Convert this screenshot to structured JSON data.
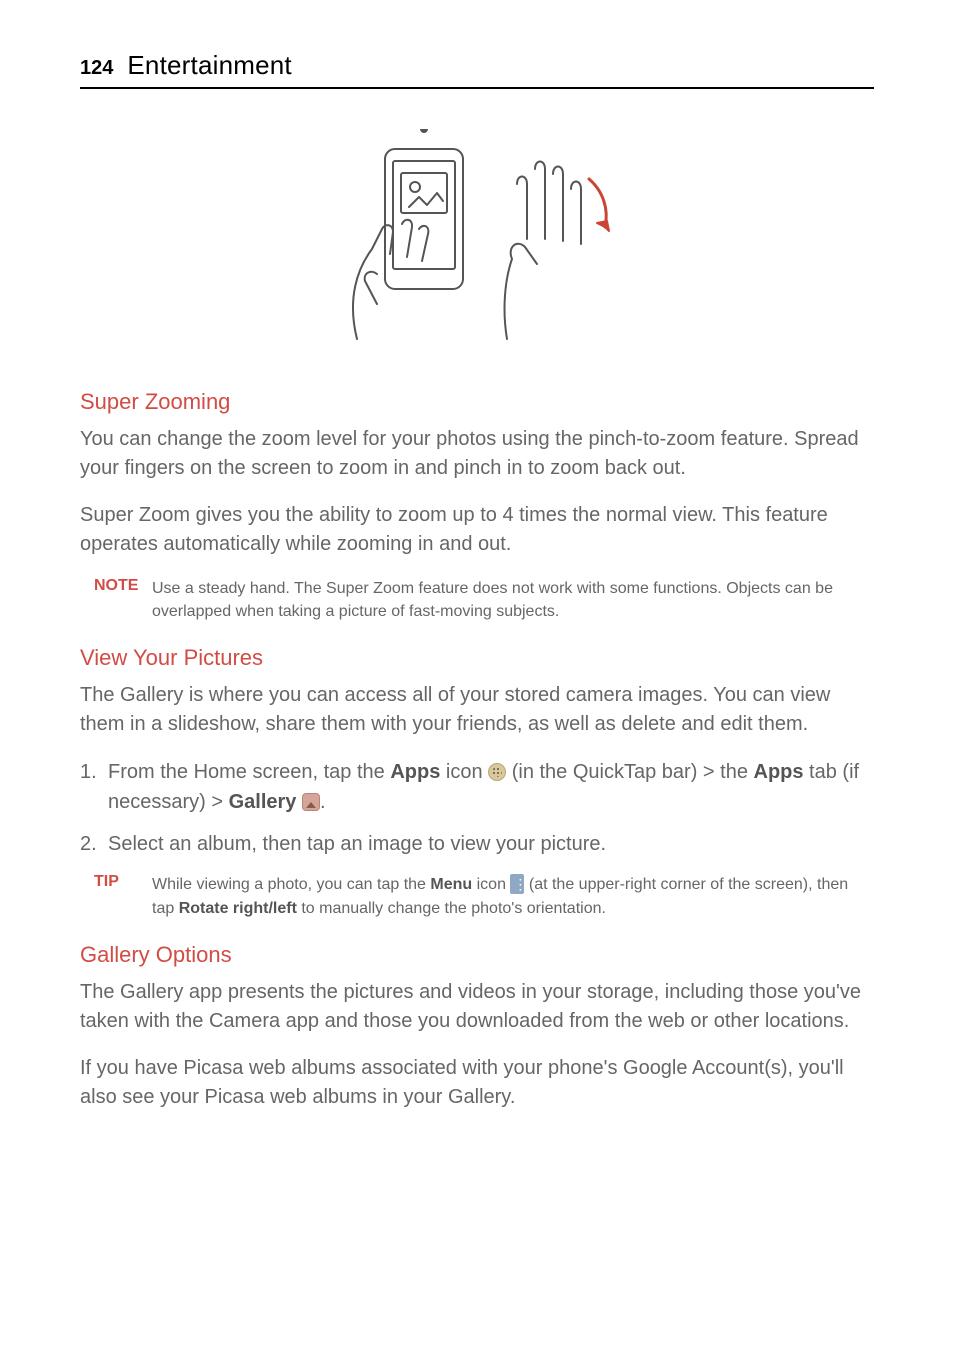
{
  "header": {
    "page_number": "124",
    "title": "Entertainment"
  },
  "sections": {
    "super_zooming": {
      "title": "Super Zooming",
      "p1": "You can change the zoom level for your photos using the pinch-to-zoom feature. Spread your fingers on the screen to zoom in and pinch in to zoom back out.",
      "p2": "Super Zoom gives you the ability to zoom up to 4 times the normal view. This feature operates automatically while zooming in and out.",
      "note_label": "NOTE",
      "note_text": "Use a steady hand. The Super Zoom feature does not work with some functions. Objects can be overlapped when taking a picture of fast-moving subjects."
    },
    "view_pictures": {
      "title": "View Your Pictures",
      "p1": "The Gallery is where you can access all of your stored camera images. You can view them in a slideshow, share them with your friends, as well as delete and edit them.",
      "step1_pre": "From the Home screen, tap the ",
      "step1_apps": "Apps",
      "step1_icon_txt": " icon ",
      "step1_mid": " (in the QuickTap bar) > the ",
      "step1_apps_tab": "Apps",
      "step1_tab_txt": " tab (if necessary) > ",
      "step1_gallery": "Gallery",
      "step1_end": ".",
      "step2": "Select an album, then tap an image to view your picture.",
      "tip_label": "TIP",
      "tip_pre": "While viewing a photo, you can tap the ",
      "tip_menu": "Menu",
      "tip_icon_txt": " icon ",
      "tip_mid": " (at the upper-right corner of the screen), then tap ",
      "tip_rotate": "Rotate right/left",
      "tip_end": " to manually change the photo's orientation."
    },
    "gallery_options": {
      "title": "Gallery Options",
      "p1": "The Gallery app presents the pictures and videos in your storage, including those you've taken with the Camera app and those you downloaded from the web or other locations.",
      "p2": "If you have Picasa web albums associated with your phone's Google Account(s), you'll also see your Picasa web albums in your Gallery."
    }
  }
}
